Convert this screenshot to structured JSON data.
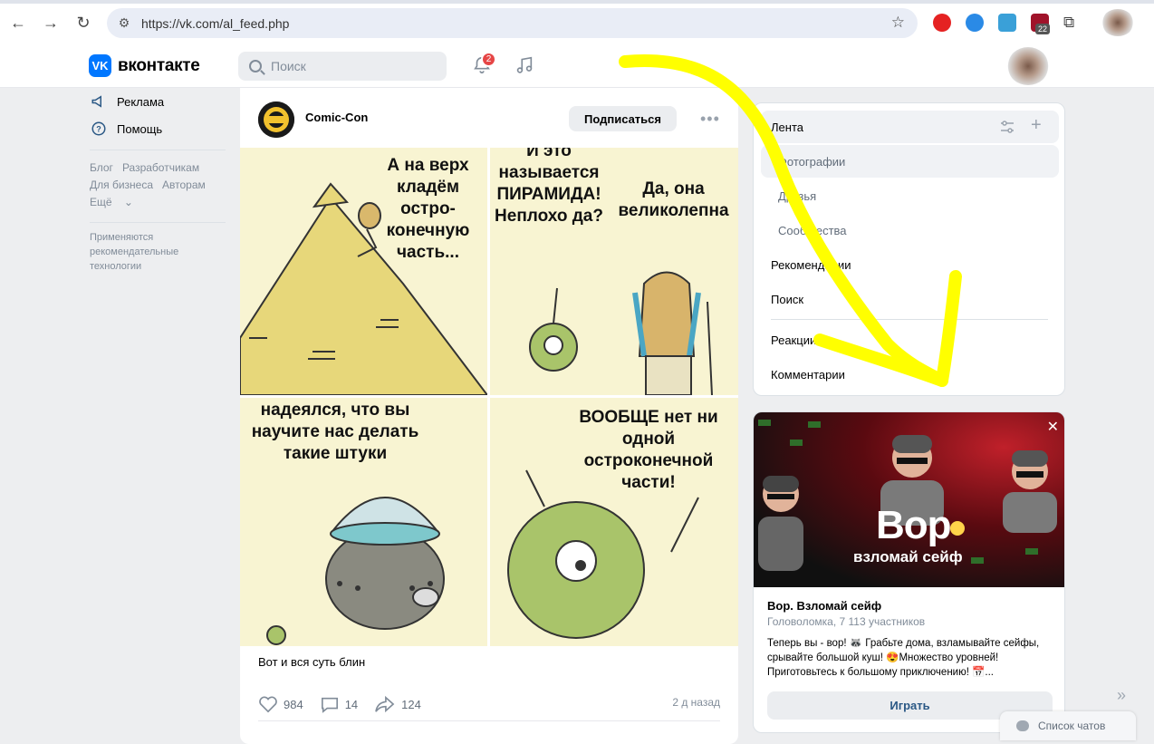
{
  "browser": {
    "url": "https://vk.com/al_feed.php",
    "ext_badge": "22"
  },
  "header": {
    "logo_text": "вконтакте",
    "search_placeholder": "Поиск",
    "notifications_count": "2"
  },
  "left_menu": {
    "items": [
      {
        "label": "Реклама",
        "icon": "megaphone-icon"
      },
      {
        "label": "Помощь",
        "icon": "help-icon"
      }
    ],
    "links": [
      "Блог",
      "Разработчикам",
      "Для бизнеса",
      "Авторам",
      "Ещё"
    ],
    "note": "Применяются рекомендательные технологии"
  },
  "post": {
    "author": "Comic-Con",
    "subscribe_label": "Подписаться",
    "comic_panels": [
      "А на верх кладём остро-конечную часть...",
      "И это называется ПИРАМИДА! Неплохо да?",
      "Да, она великолепна",
      "надеялся, что вы научите нас делать такие штуки",
      "ВООБЩЕ нет ни одной остроконечной части!"
    ],
    "text": "Вот и вся суть блин",
    "likes": "984",
    "comments": "14",
    "shares": "124",
    "time": "2 д назад"
  },
  "filter_menu": {
    "feed": "Лента",
    "sub_items": [
      "Фотографии",
      "Друзья",
      "Сообщества"
    ],
    "items": [
      "Рекомендации",
      "Поиск"
    ],
    "items2": [
      "Реакции",
      "Комментарии"
    ]
  },
  "ad": {
    "banner_title": "Вор",
    "banner_subtitle": "взломай сейф",
    "name": "Вор. Взломай сейф",
    "meta": "Головоломка, 7 113 участников",
    "description": "Теперь вы - вор! 🦝 Грабьте дома, взламывайте сейфы, срывайте большой куш! 😍Множество уровней! Приготовьтесь к большому приключению! 📅...",
    "button": "Играть"
  },
  "chat": {
    "label": "Список чатов"
  },
  "colors": {
    "accent": "#0077ff",
    "link": "#2a5885",
    "annotation": "#ffff00"
  }
}
